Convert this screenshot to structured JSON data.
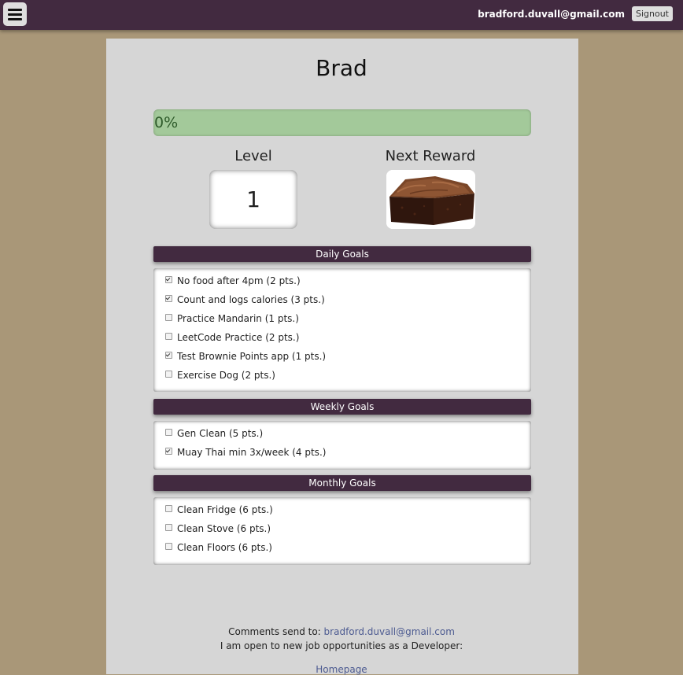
{
  "topbar": {
    "menu_icon": "hamburger-menu-icon",
    "user_email": "bradford.duvall@gmail.com",
    "signout_label": "Signout"
  },
  "profile": {
    "name": "Brad",
    "progress_text": "0%",
    "progress_fraction": 0,
    "level_label": "Level",
    "level_value": "1",
    "next_reward_label": "Next Reward",
    "reward_image": "brownie"
  },
  "daily": {
    "title": "Daily Goals",
    "items": [
      {
        "label": "No food after 4pm (2 pts.)",
        "checked": true
      },
      {
        "label": "Count and logs calories (3 pts.)",
        "checked": true
      },
      {
        "label": "Practice Mandarin (1 pts.)",
        "checked": false
      },
      {
        "label": "LeetCode Practice (2 pts.)",
        "checked": false
      },
      {
        "label": "Test Brownie Points app (1 pts.)",
        "checked": true
      },
      {
        "label": "Exercise Dog (2 pts.)",
        "checked": false
      }
    ]
  },
  "weekly": {
    "title": "Weekly Goals",
    "items": [
      {
        "label": "Gen Clean (5 pts.)",
        "checked": false
      },
      {
        "label": "Muay Thai min 3x/week (4 pts.)",
        "checked": true
      }
    ]
  },
  "monthly": {
    "title": "Monthly Goals",
    "items": [
      {
        "label": "Clean Fridge (6 pts.)",
        "checked": false
      },
      {
        "label": "Clean Stove (6 pts.)",
        "checked": false
      },
      {
        "label": "Clean Floors (6 pts.)",
        "checked": false
      }
    ]
  },
  "footer": {
    "comments_prefix": "Comments send to:",
    "comments_email": "bradford.duvall@gmail.com",
    "jobs_text": "I am open to new job opportunities as a Developer:",
    "homepage_link": "Homepage"
  },
  "colors": {
    "background": "#a99778",
    "topbar": "#422a40",
    "panel": "#d6d6d6",
    "progress": "#a3c99a",
    "link": "#4d5b91"
  }
}
